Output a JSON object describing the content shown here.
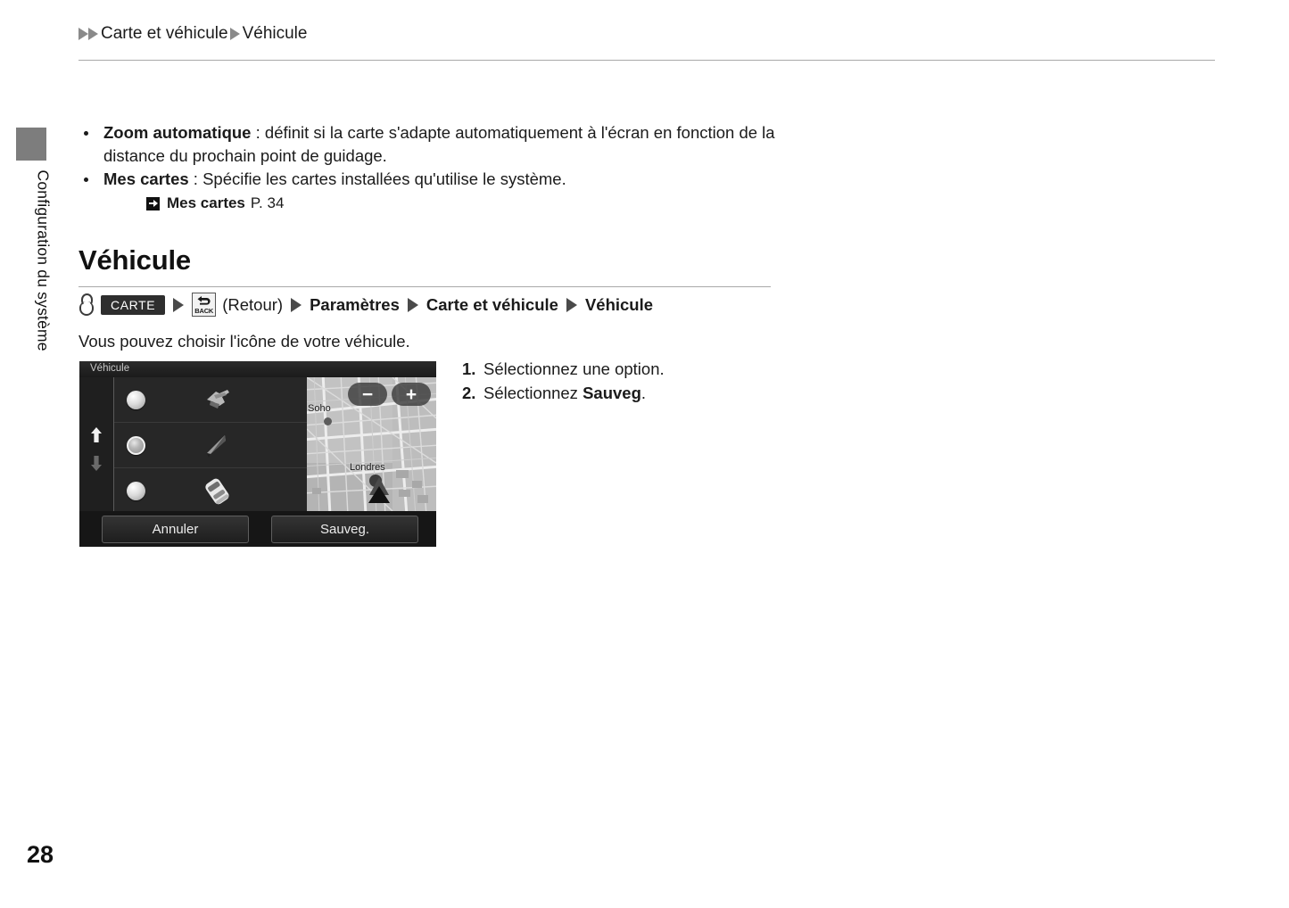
{
  "side_tab": {
    "label": "Configuration du système"
  },
  "breadcrumb": {
    "item1": "Carte et véhicule",
    "item2": "Véhicule"
  },
  "bullets": [
    {
      "term": "Zoom automatique",
      "separator": " : ",
      "text": "définit si la carte s'adapte automatiquement à l'écran en fonction de la distance du prochain point de guidage."
    },
    {
      "term": "Mes cartes",
      "separator": " : ",
      "text": "Spécifie les cartes installées qu'utilise le système."
    }
  ],
  "reference": {
    "icon": "arrow-right-box-icon",
    "target": "Mes cartes",
    "page": "P. 34"
  },
  "section": {
    "heading": "Véhicule",
    "lead": "Vous pouvez choisir l'icône de votre véhicule."
  },
  "navpath": {
    "hand_icon": "hand-pointer-icon",
    "carte_key": "CARTE",
    "back_key_label": "BACK",
    "back_icon": "back-arrow-icon",
    "retour": "(Retour)",
    "item1": "Paramètres",
    "item2": "Carte et véhicule",
    "item3": "Véhicule"
  },
  "steps": [
    {
      "number": "1.",
      "text": "Sélectionnez une option.",
      "bold_tail": "",
      "tail": ""
    },
    {
      "number": "2.",
      "prefix": "Sélectionnez ",
      "bold": "Sauveg",
      "suffix": "."
    }
  ],
  "device_screen": {
    "title": "Véhicule",
    "scroll": {
      "up_icon": "arrow-up-icon",
      "down_icon": "arrow-down-icon",
      "up_enabled": true,
      "down_enabled": false
    },
    "vehicle_rows": [
      {
        "icon": "jet-vehicle-icon",
        "selected": false
      },
      {
        "icon": "arrow-cone-vehicle-icon",
        "selected": true
      },
      {
        "icon": "car-vehicle-icon",
        "selected": false
      }
    ],
    "map": {
      "zoom_out_label": "−",
      "zoom_in_label": "+",
      "labels": [
        {
          "name": "Soho"
        },
        {
          "name": "Londres"
        }
      ],
      "marker_icon": "vehicle-position-marker-icon"
    },
    "buttons": {
      "cancel": "Annuler",
      "save": "Sauveg."
    }
  },
  "page_number": "28",
  "colors": {
    "rule": "#a9a9a9",
    "tab_block": "#7d7d7d",
    "key_dark": "#2e2e2e",
    "screen_bg": "#1d1d1d"
  }
}
